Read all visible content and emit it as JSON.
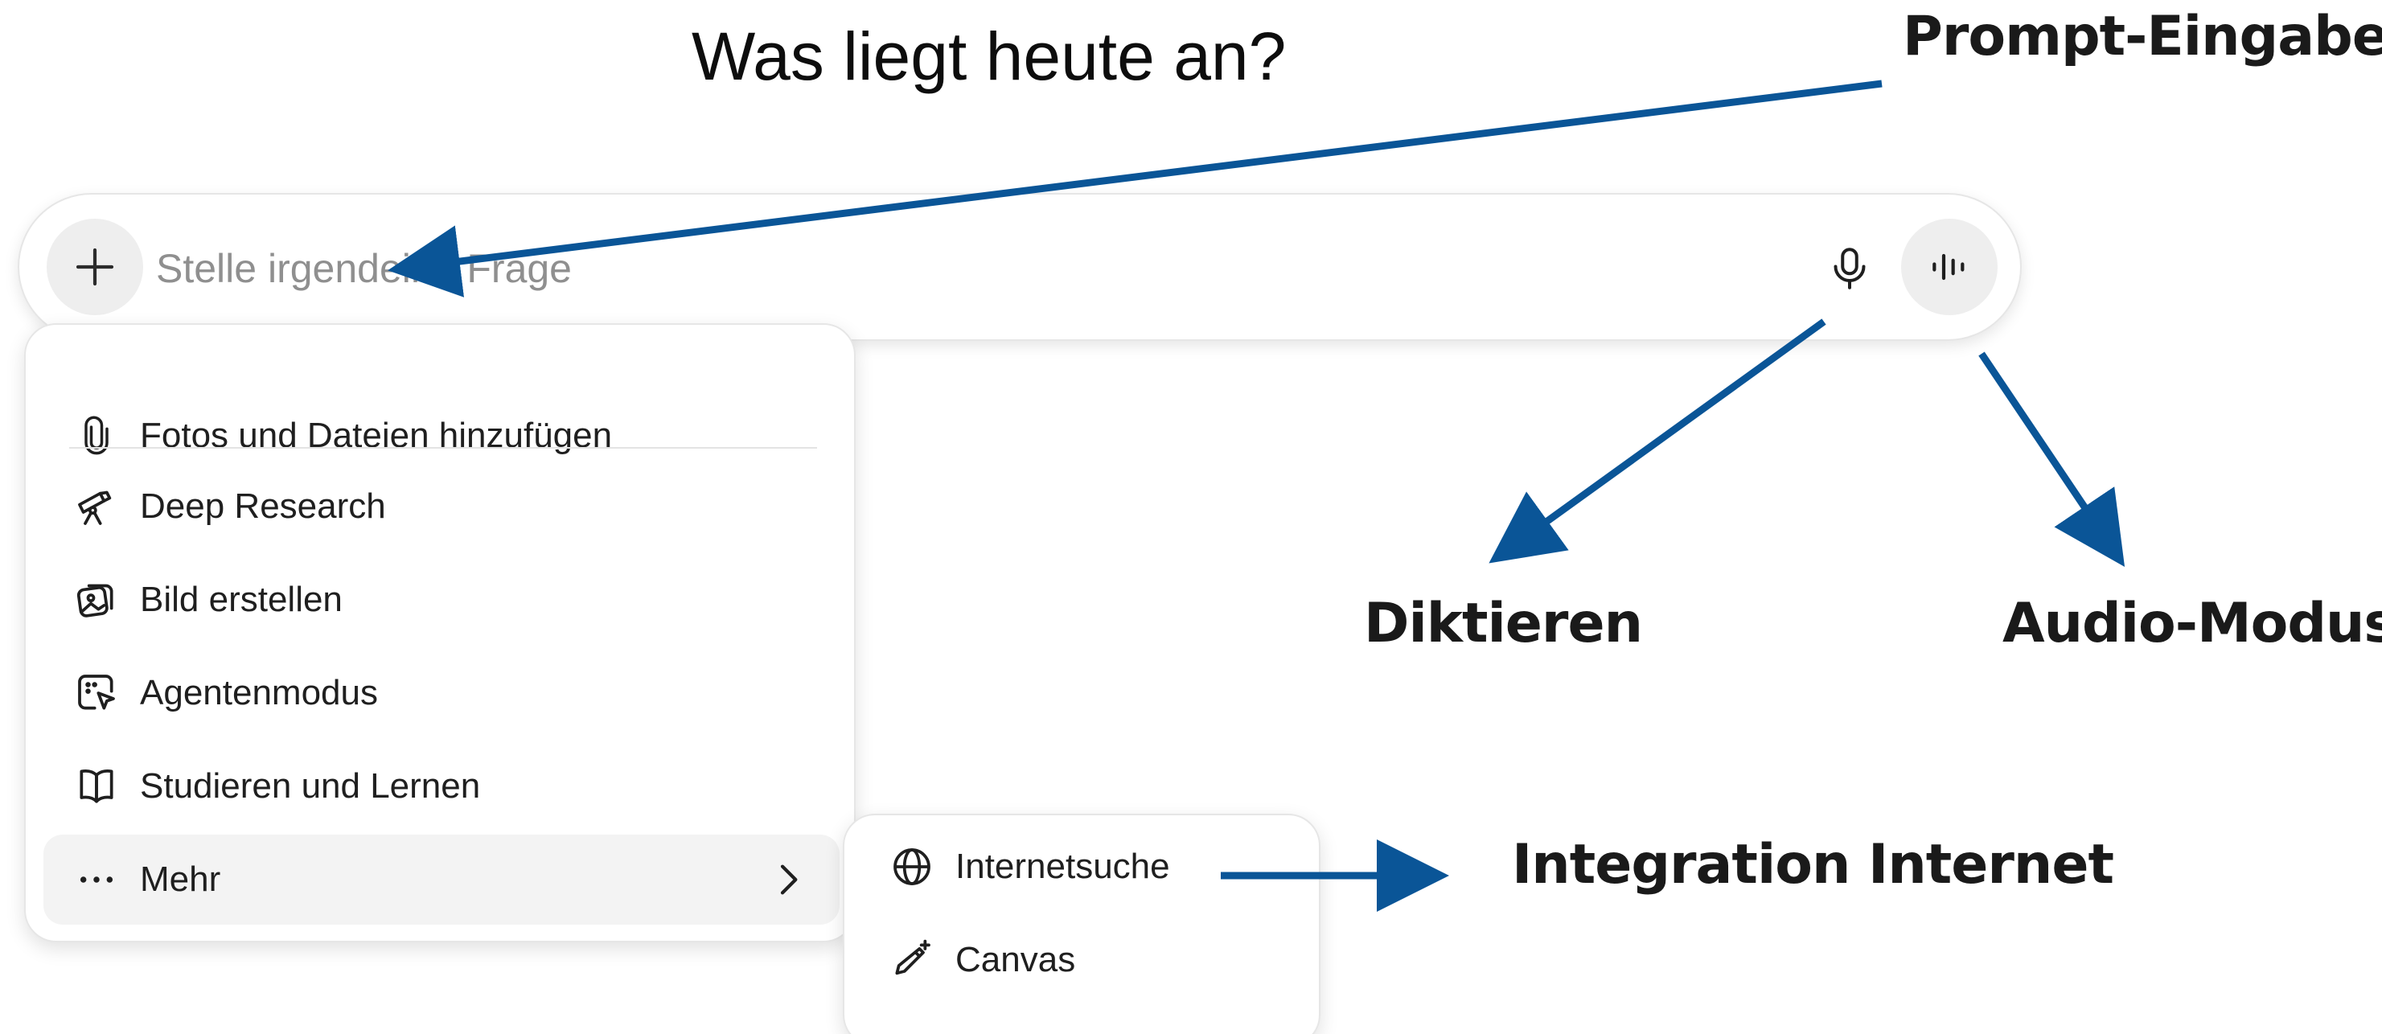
{
  "headline": "Was liegt heute an?",
  "prompt": {
    "placeholder": "Stelle irgendeine Frage",
    "value": ""
  },
  "menu": {
    "items": [
      {
        "icon": "paperclip-icon",
        "label": "Fotos und Dateien hinzufügen"
      },
      {
        "icon": "telescope-icon",
        "label": "Deep Research"
      },
      {
        "icon": "image-create-icon",
        "label": "Bild erstellen"
      },
      {
        "icon": "agent-cursor-icon",
        "label": "Agentenmodus"
      },
      {
        "icon": "book-open-icon",
        "label": "Studieren und Lernen"
      },
      {
        "icon": "more-dots-icon",
        "label": "Mehr"
      }
    ]
  },
  "submenu": {
    "items": [
      {
        "icon": "globe-icon",
        "label": "Internetsuche"
      },
      {
        "icon": "canvas-pen-icon",
        "label": "Canvas"
      }
    ]
  },
  "annotations": {
    "prompt_input": "Prompt-Eingabe",
    "dictate": "Diktieren",
    "audio_mode": "Audio-Modus",
    "internet": "Integration Internet",
    "arrow_color": "#0a5597"
  }
}
